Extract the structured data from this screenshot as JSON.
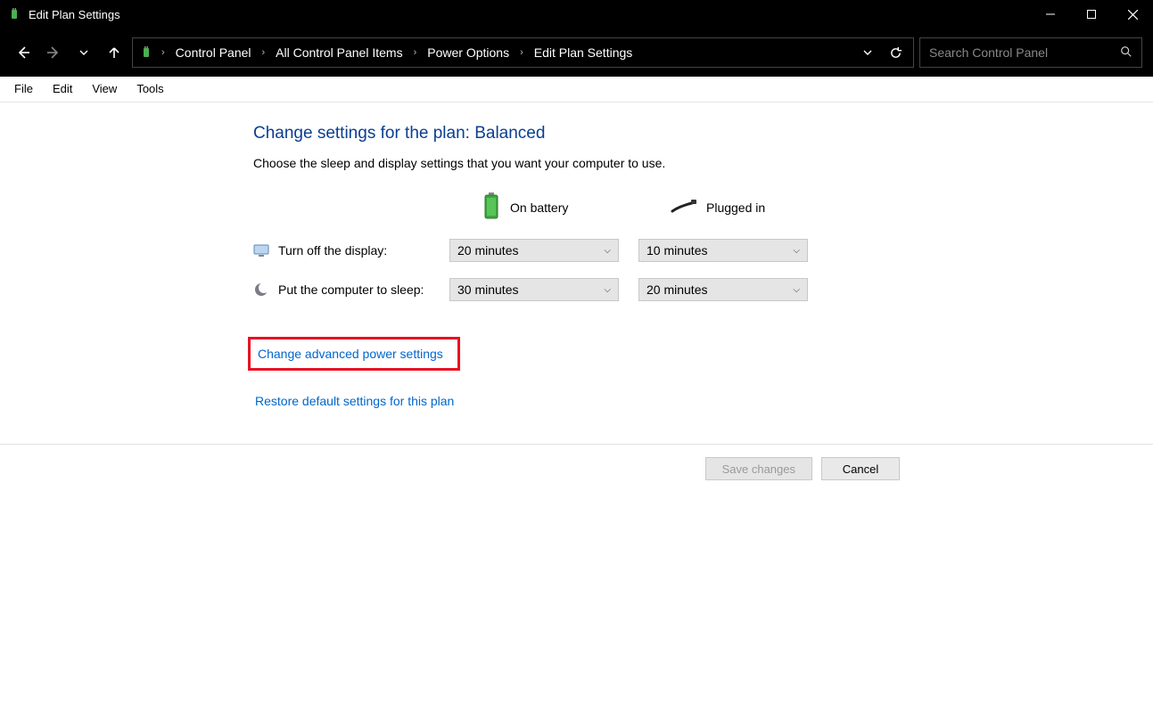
{
  "window": {
    "title": "Edit Plan Settings"
  },
  "breadcrumb": {
    "items": [
      "Control Panel",
      "All Control Panel Items",
      "Power Options",
      "Edit Plan Settings"
    ]
  },
  "search": {
    "placeholder": "Search Control Panel"
  },
  "menu": {
    "items": [
      "File",
      "Edit",
      "View",
      "Tools"
    ]
  },
  "page": {
    "heading": "Change settings for the plan: Balanced",
    "subtext": "Choose the sleep and display settings that you want your computer to use.",
    "columns": {
      "battery": "On battery",
      "plugged": "Plugged in"
    },
    "rows": [
      {
        "label": "Turn off the display:",
        "battery_value": "20 minutes",
        "plugged_value": "10 minutes"
      },
      {
        "label": "Put the computer to sleep:",
        "battery_value": "30 minutes",
        "plugged_value": "20 minutes"
      }
    ],
    "links": {
      "advanced": "Change advanced power settings",
      "restore": "Restore default settings for this plan"
    }
  },
  "footer": {
    "save": "Save changes",
    "cancel": "Cancel"
  }
}
